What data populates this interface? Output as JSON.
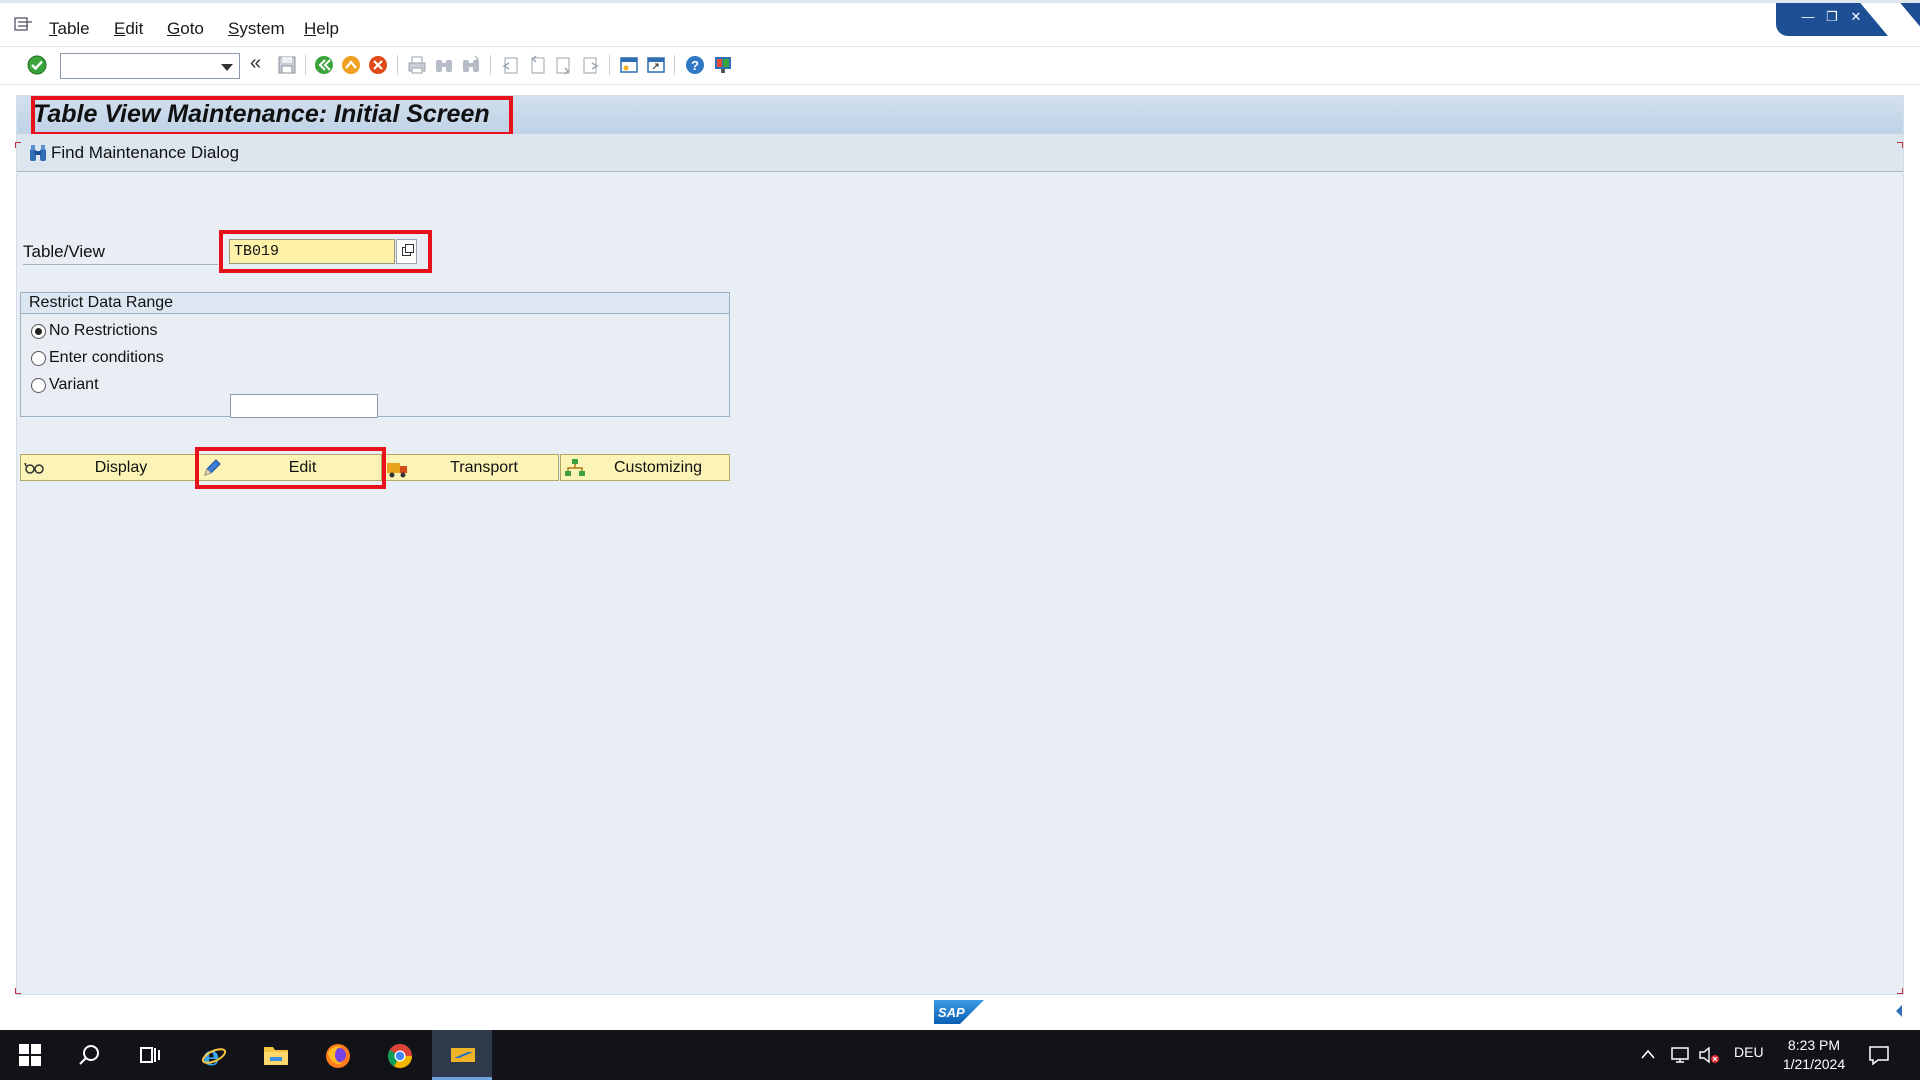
{
  "menu": {
    "items": [
      "Table",
      "Edit",
      "Goto",
      "System",
      "Help"
    ]
  },
  "toolbar": {
    "command_field_value": "",
    "icons": [
      "enter-icon",
      "back-icon",
      "save-icon",
      "back-green-icon",
      "exit-icon",
      "cancel-icon",
      "print-icon",
      "find-icon",
      "find-next-icon",
      "first-page-icon",
      "previous-page-icon",
      "next-page-icon",
      "last-page-icon",
      "new-session-icon",
      "shortcut-icon",
      "help-icon",
      "customize-layout-icon"
    ]
  },
  "screen": {
    "title": "Table View Maintenance: Initial Screen",
    "app_toolbar": {
      "find_maintenance_dialog": "Find Maintenance Dialog"
    },
    "table_view": {
      "label": "Table/View",
      "value": "TB019"
    },
    "restrict": {
      "heading": "Restrict Data Range",
      "options": [
        {
          "label": "No Restrictions",
          "selected": true
        },
        {
          "label": "Enter conditions",
          "selected": false
        },
        {
          "label": "Variant",
          "selected": false
        }
      ],
      "variant_value": ""
    },
    "actions": {
      "display": "Display",
      "edit": "Edit",
      "transport": "Transport",
      "customizing": "Customizing"
    }
  },
  "taskbar": {
    "language": "DEU",
    "time": "8:23 PM",
    "date": "1/21/2024"
  },
  "colors": {
    "highlight": "#e8101a",
    "button_bg": "#fbf4b6",
    "input_required_bg": "#fef2a8",
    "sap_blue": "#1d4f95"
  }
}
